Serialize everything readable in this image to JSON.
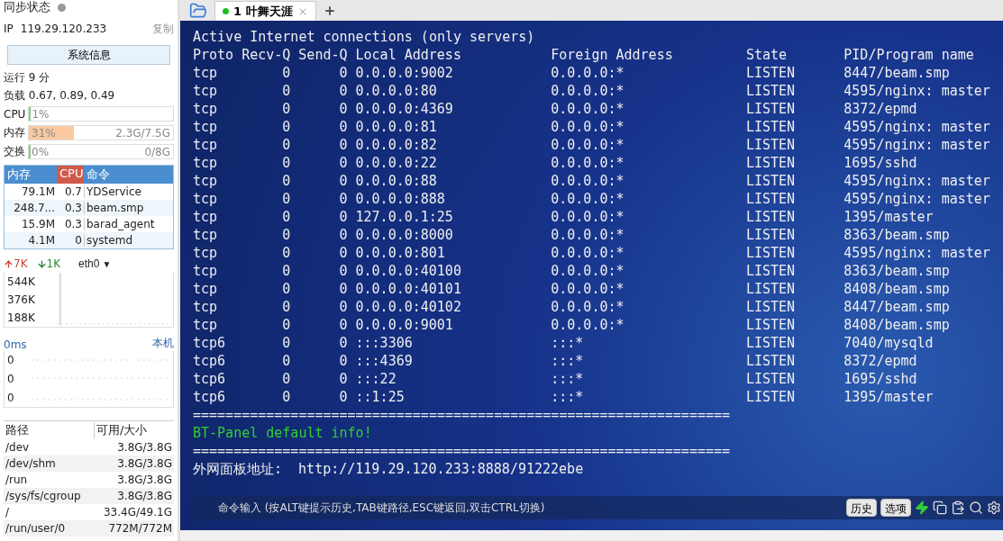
{
  "sidebar": {
    "sync_status": {
      "label": "同步状态",
      "on": false
    },
    "ip": {
      "label": "IP",
      "value": "119.29.120.233",
      "copy": "复制"
    },
    "system_info_button": "系统信息",
    "uptime": "运行 9 分",
    "load": "负载 0.67, 0.89, 0.49",
    "meters": [
      {
        "label": "CPU",
        "value": "1%",
        "level": 0.01
      },
      {
        "label": "内存",
        "value": "31%",
        "detail": "2.3G/7.5G",
        "level": 0.31
      },
      {
        "label": "交换",
        "value": "0%",
        "detail": "0/8G",
        "level": 0
      }
    ],
    "process_table": {
      "columns": [
        {
          "label": "内存",
          "sorted": false
        },
        {
          "label": "CPU",
          "sorted": true
        },
        {
          "label": "命令",
          "sorted": false
        }
      ],
      "rows": [
        [
          "79.1M",
          "0.7",
          "YDService"
        ],
        [
          "248.7...",
          "0.3",
          "beam.smp"
        ],
        [
          "15.9M",
          "0.3",
          "barad_agent"
        ],
        [
          "4.1M",
          "0",
          "systemd"
        ]
      ]
    },
    "network": {
      "up": "7K",
      "down": "1K",
      "interface": "eth0",
      "interface_caret": "▼",
      "y_labels": [
        "544K",
        "376K",
        "188K"
      ]
    },
    "ping": {
      "latency": "0ms",
      "target": "本机",
      "values": [
        "0",
        "0",
        "0"
      ]
    },
    "disk_table": {
      "columns": [
        "路径",
        "可用/大小"
      ],
      "rows": [
        [
          "/dev",
          "3.8G/3.8G"
        ],
        [
          "/dev/shm",
          "3.8G/3.8G"
        ],
        [
          "/run",
          "3.8G/3.8G"
        ],
        [
          "/sys/fs/cgroup",
          "3.8G/3.8G"
        ],
        [
          "/",
          "33.4G/49.1G"
        ],
        [
          "/run/user/0",
          "772M/772M"
        ]
      ]
    }
  },
  "tabs": [
    {
      "label": "1 叶舞天涯",
      "selected": true,
      "connected": true
    }
  ],
  "terminal": {
    "heading": "Active Internet connections (only servers)",
    "table": {
      "columns": [
        "Proto",
        "Recv-Q",
        "Send-Q",
        "Local Address",
        "Foreign Address",
        "State",
        "PID/Program name"
      ],
      "rows": [
        [
          "tcp",
          "0",
          "0",
          "0.0.0.0:9002",
          "0.0.0.0:*",
          "LISTEN",
          "8447/beam.smp"
        ],
        [
          "tcp",
          "0",
          "0",
          "0.0.0.0:80",
          "0.0.0.0:*",
          "LISTEN",
          "4595/nginx: master"
        ],
        [
          "tcp",
          "0",
          "0",
          "0.0.0.0:4369",
          "0.0.0.0:*",
          "LISTEN",
          "8372/epmd"
        ],
        [
          "tcp",
          "0",
          "0",
          "0.0.0.0:81",
          "0.0.0.0:*",
          "LISTEN",
          "4595/nginx: master"
        ],
        [
          "tcp",
          "0",
          "0",
          "0.0.0.0:82",
          "0.0.0.0:*",
          "LISTEN",
          "4595/nginx: master"
        ],
        [
          "tcp",
          "0",
          "0",
          "0.0.0.0:22",
          "0.0.0.0:*",
          "LISTEN",
          "1695/sshd"
        ],
        [
          "tcp",
          "0",
          "0",
          "0.0.0.0:88",
          "0.0.0.0:*",
          "LISTEN",
          "4595/nginx: master"
        ],
        [
          "tcp",
          "0",
          "0",
          "0.0.0.0:888",
          "0.0.0.0:*",
          "LISTEN",
          "4595/nginx: master"
        ],
        [
          "tcp",
          "0",
          "0",
          "127.0.0.1:25",
          "0.0.0.0:*",
          "LISTEN",
          "1395/master"
        ],
        [
          "tcp",
          "0",
          "0",
          "0.0.0.0:8000",
          "0.0.0.0:*",
          "LISTEN",
          "8363/beam.smp"
        ],
        [
          "tcp",
          "0",
          "0",
          "0.0.0.0:801",
          "0.0.0.0:*",
          "LISTEN",
          "4595/nginx: master"
        ],
        [
          "tcp",
          "0",
          "0",
          "0.0.0.0:40100",
          "0.0.0.0:*",
          "LISTEN",
          "8363/beam.smp"
        ],
        [
          "tcp",
          "0",
          "0",
          "0.0.0.0:40101",
          "0.0.0.0:*",
          "LISTEN",
          "8408/beam.smp"
        ],
        [
          "tcp",
          "0",
          "0",
          "0.0.0.0:40102",
          "0.0.0.0:*",
          "LISTEN",
          "8447/beam.smp"
        ],
        [
          "tcp",
          "0",
          "0",
          "0.0.0.0:9001",
          "0.0.0.0:*",
          "LISTEN",
          "8408/beam.smp"
        ],
        [
          "tcp6",
          "0",
          "0",
          ":::3306",
          ":::*",
          "LISTEN",
          "7040/mysqld"
        ],
        [
          "tcp6",
          "0",
          "0",
          ":::4369",
          ":::*",
          "LISTEN",
          "8372/epmd"
        ],
        [
          "tcp6",
          "0",
          "0",
          ":::22",
          ":::*",
          "LISTEN",
          "1695/sshd"
        ],
        [
          "tcp6",
          "0",
          "0",
          "::1:25",
          ":::*",
          "LISTEN",
          "1395/master"
        ]
      ]
    },
    "footer_lines": [
      {
        "kind": "plain",
        "text": "=================================================================="
      },
      {
        "kind": "green",
        "text": "BT-Panel default info!"
      },
      {
        "kind": "plain",
        "text": "=================================================================="
      },
      {
        "kind": "plain",
        "text": "外网面板地址:  http://119.29.120.233:8888/91222ebe"
      }
    ]
  },
  "command_bar": {
    "placeholder": "命令输入 (按ALT键提示历史,TAB键路径,ESC键返回,双击CTRL切换)",
    "buttons": [
      "历史",
      "选项"
    ]
  }
}
